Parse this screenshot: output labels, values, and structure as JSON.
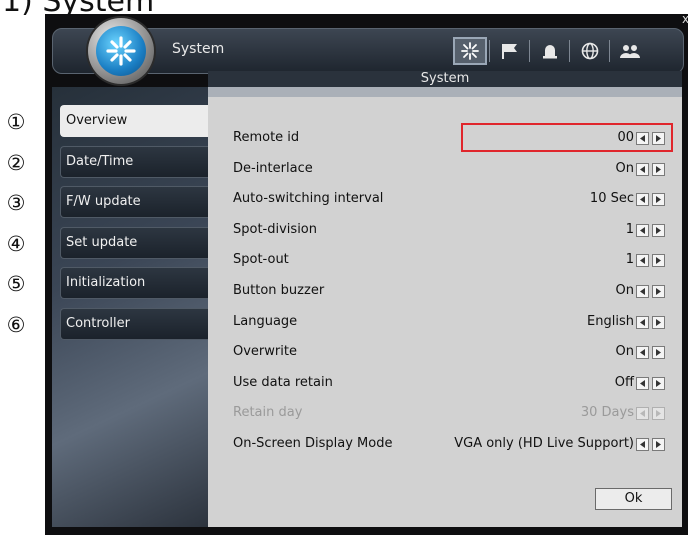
{
  "document": {
    "heading": "1)   System",
    "markers": [
      "①",
      "②",
      "③",
      "④",
      "⑤",
      "⑥"
    ]
  },
  "window": {
    "title": "System",
    "subtitle": "System",
    "close_glyph": "x",
    "toolbar_icons": [
      "system-icon",
      "flag-icon",
      "alarm-icon",
      "network-icon",
      "users-icon"
    ]
  },
  "sidebar": {
    "items": [
      {
        "label": "Overview",
        "active": true
      },
      {
        "label": "Date/Time",
        "active": false
      },
      {
        "label": "F/W update",
        "active": false
      },
      {
        "label": "Set update",
        "active": false
      },
      {
        "label": "Initialization",
        "active": false
      },
      {
        "label": "Controller",
        "active": false
      }
    ]
  },
  "settings": [
    {
      "label": "Remote id",
      "value": "00",
      "enabled": true
    },
    {
      "label": "De-interlace",
      "value": "On",
      "enabled": true
    },
    {
      "label": "Auto-switching interval",
      "value": "10 Sec",
      "enabled": true
    },
    {
      "label": "Spot-division",
      "value": "1",
      "enabled": true
    },
    {
      "label": "Spot-out",
      "value": "1",
      "enabled": true
    },
    {
      "label": "Button buzzer",
      "value": "On",
      "enabled": true
    },
    {
      "label": "Language",
      "value": "English",
      "enabled": true
    },
    {
      "label": "Overwrite",
      "value": "On",
      "enabled": true
    },
    {
      "label": "Use data retain",
      "value": "Off",
      "enabled": true
    },
    {
      "label": "Retain day",
      "value": "30 Days",
      "enabled": false
    },
    {
      "label": "On-Screen Display Mode",
      "value": "VGA only (HD Live Support)",
      "enabled": true
    }
  ],
  "buttons": {
    "ok": "Ok"
  },
  "colors": {
    "highlight": "#e0262c",
    "panel": "#d2d2d2",
    "accent_blue": "#1b7fc4"
  }
}
